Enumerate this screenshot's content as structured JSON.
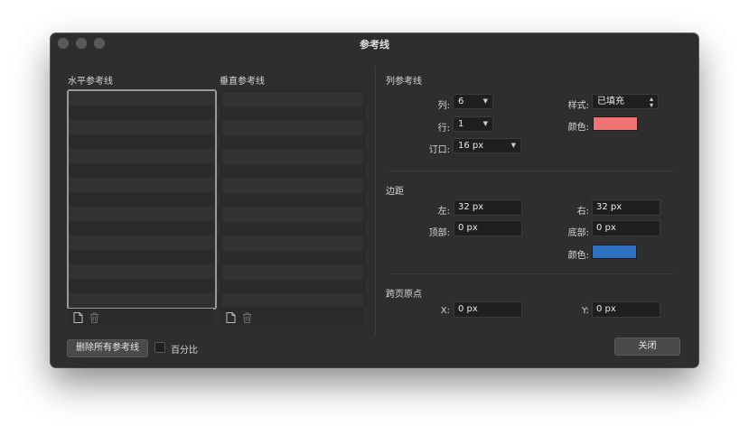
{
  "window": {
    "title": "参考线"
  },
  "horizontal_guides": {
    "label": "水平参考线",
    "rows": 15
  },
  "vertical_guides": {
    "label": "垂直参考线",
    "rows": 15
  },
  "column_guides": {
    "section_label": "列参考线",
    "columns_label": "列:",
    "columns_value": "6",
    "rows_label": "行:",
    "rows_value": "1",
    "gutter_label": "订口:",
    "gutter_value": "16 px",
    "style_label": "样式:",
    "style_value": "已填充",
    "color_label": "颜色:",
    "color": "#f07272"
  },
  "margins": {
    "section_label": "边距",
    "left_label": "左:",
    "left_value": "32 px",
    "right_label": "右:",
    "right_value": "32 px",
    "top_label": "顶部:",
    "top_value": "0 px",
    "bottom_label": "底部:",
    "bottom_value": "0 px",
    "color_label": "颜色:",
    "color": "#2e6fc0"
  },
  "spread_origin": {
    "section_label": "跨页原点",
    "x_label": "X:",
    "x_value": "0 px",
    "y_label": "Y:",
    "y_value": "0 px"
  },
  "footer": {
    "delete_all_label": "删除所有参考线",
    "percent_label": "百分比",
    "close_label": "关闭"
  },
  "icons": {
    "add": "new-document-icon",
    "delete": "trash-icon"
  }
}
